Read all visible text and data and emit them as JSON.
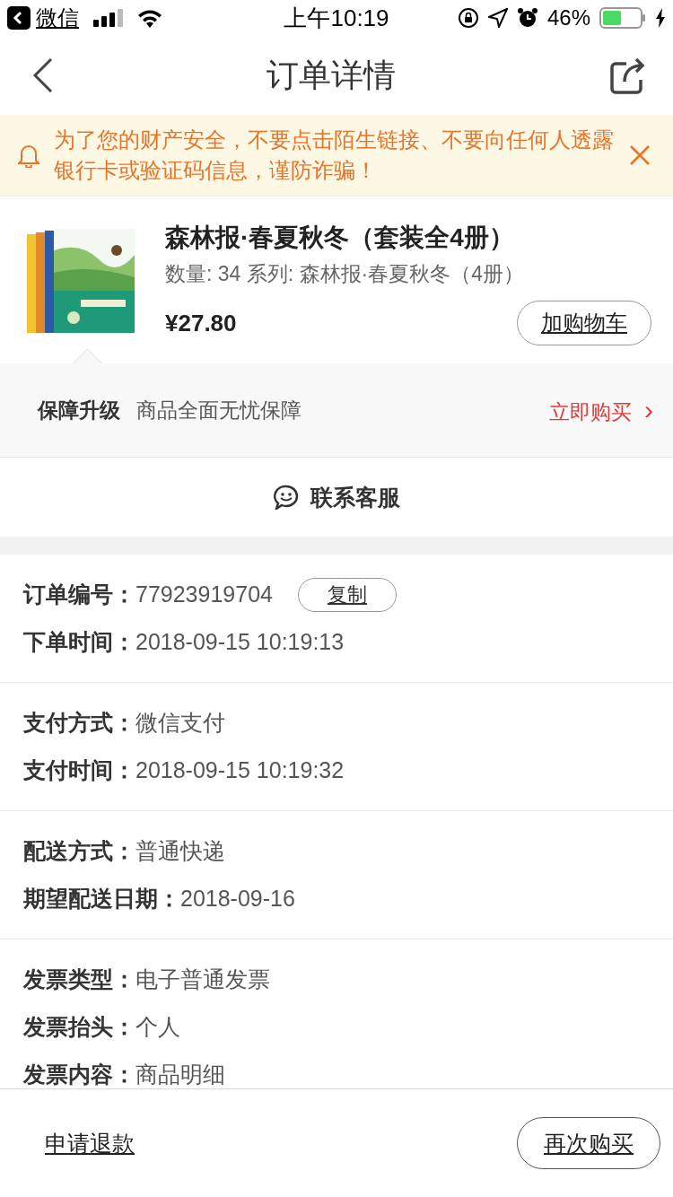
{
  "status_bar": {
    "back_app": "微信",
    "time": "上午10:19",
    "battery": "46%"
  },
  "nav": {
    "title": "订单详情"
  },
  "notice": {
    "text": "为了您的财产安全，不要点击陌生链接、不要向任何人透露银行卡或验证码信息，谨防诈骗！"
  },
  "product": {
    "title": "森林报·春夏秋冬（套装全4册）",
    "meta": "数量: 34 系列: 森林报·春夏秋冬（4册）",
    "price": "¥27.80",
    "button": "加购物车"
  },
  "guarantee": {
    "label": "保障升级",
    "desc": "商品全面无忧保障",
    "action": "立即购买",
    "chevron": "›"
  },
  "contact": {
    "label": "联系客服"
  },
  "sections": [
    {
      "rows": [
        {
          "label": "订单编号：",
          "value": "77923919704",
          "button": "复制"
        },
        {
          "label": "下单时间：",
          "value": "2018-09-15 10:19:13"
        }
      ]
    },
    {
      "rows": [
        {
          "label": "支付方式：",
          "value": "微信支付"
        },
        {
          "label": "支付时间：",
          "value": "2018-09-15 10:19:32"
        }
      ]
    },
    {
      "rows": [
        {
          "label": "配送方式：",
          "value": "普通快递"
        },
        {
          "label": "期望配送日期：",
          "value": "2018-09-16"
        }
      ]
    },
    {
      "rows": [
        {
          "label": "发票类型：",
          "value": "电子普通发票"
        },
        {
          "label": "发票抬头：",
          "value": "个人"
        },
        {
          "label": "发票内容：",
          "value": "商品明细"
        }
      ]
    }
  ],
  "bottom_bar": {
    "refund": "申请退款",
    "rebuy": "再次购买"
  }
}
